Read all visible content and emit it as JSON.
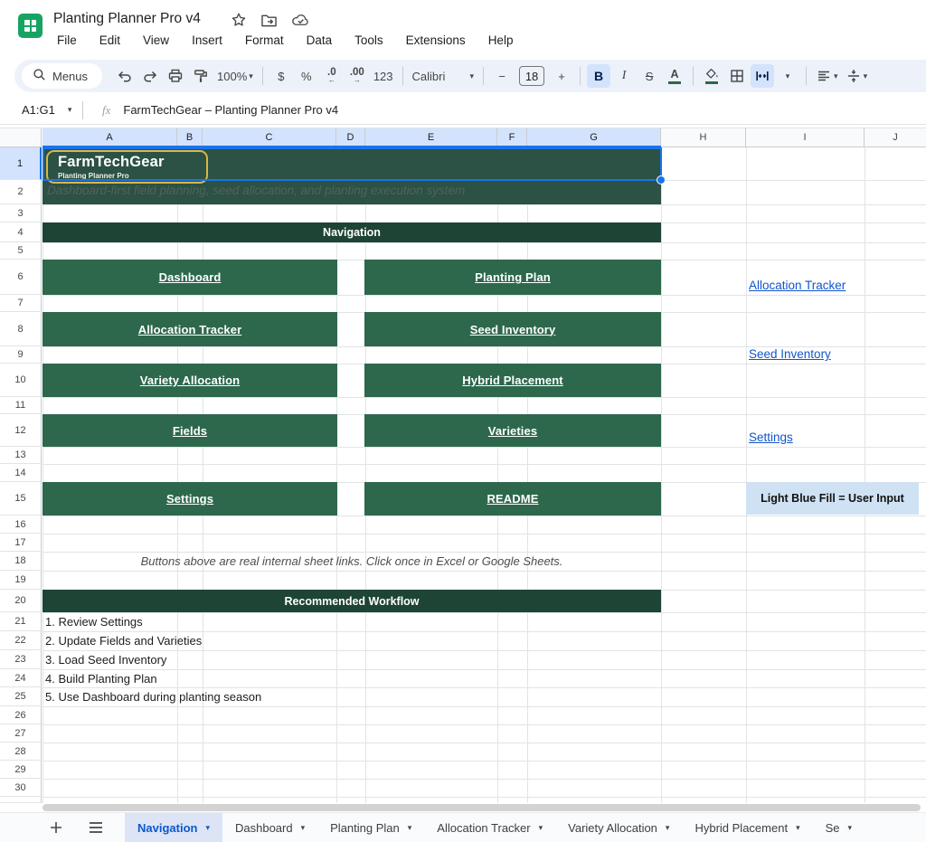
{
  "titlebar": {
    "title": "Planting Planner Pro v4",
    "menus": [
      "File",
      "Edit",
      "View",
      "Insert",
      "Format",
      "Data",
      "Tools",
      "Extensions",
      "Help"
    ]
  },
  "toolbar": {
    "search_label": "Menus",
    "zoom": "100%",
    "currency": "$",
    "percent": "%",
    "decrease_decimal": ".0",
    "decrease_decimal_arrow": "←",
    "increase_decimal": ".00",
    "increase_decimal_arrow": "→",
    "more_formats": "123",
    "font": "Calibri",
    "minus": "−",
    "font_size": "18",
    "plus": "+",
    "bold": "B",
    "italic": "I",
    "strikethrough": "S",
    "text_color": "A",
    "caret": "▾"
  },
  "formula_bar": {
    "range": "A1:G1",
    "fx": "fx",
    "formula": "FarmTechGear – Planting Planner Pro v4"
  },
  "grid": {
    "columns": [
      "A",
      "B",
      "C",
      "D",
      "E",
      "F",
      "G",
      "H",
      "I",
      "J"
    ],
    "selected_columns": 7,
    "rows": 30,
    "selected_row": 1
  },
  "content": {
    "banner": {
      "logo_title": "FarmTechGear",
      "logo_subtitle": "Planting Planner Pro",
      "subtitle": "Dashboard-first field planning, seed allocation, and planting execution system"
    },
    "nav_header": "Navigation",
    "nav_buttons": [
      [
        "Dashboard",
        "Planting Plan"
      ],
      [
        "Allocation Tracker",
        "Seed Inventory"
      ],
      [
        "Variety Allocation",
        "Hybrid Placement"
      ],
      [
        "Fields",
        "Varieties"
      ],
      [
        "Settings",
        "README"
      ]
    ],
    "side_links": [
      "Allocation Tracker",
      "Seed Inventory",
      "Settings"
    ],
    "legend": "Light Blue Fill = User Input",
    "note": "Buttons above are real internal sheet links. Click once in Excel or Google Sheets.",
    "workflow_header": "Recommended Workflow",
    "workflow_items": [
      "1. Review Settings",
      "2. Update Fields and Varieties",
      "3. Load Seed Inventory",
      "4. Build Planting Plan",
      "5. Use Dashboard during planting season"
    ]
  },
  "tabbar": {
    "tabs": [
      {
        "label": "Navigation",
        "active": true
      },
      {
        "label": "Dashboard",
        "active": false
      },
      {
        "label": "Planting Plan",
        "active": false
      },
      {
        "label": "Allocation Tracker",
        "active": false
      },
      {
        "label": "Variety Allocation",
        "active": false
      },
      {
        "label": "Hybrid Placement",
        "active": false
      },
      {
        "label": "Se",
        "active": false
      }
    ]
  },
  "colors": {
    "accent_blue": "#1a73e8",
    "link_blue": "#1155cc",
    "banner_green": "#2b5244",
    "section_green": "#1d4434",
    "button_green": "#2d684c",
    "gold_border": "#d9b64a",
    "legend_blue": "#cfe2f3",
    "selected_header": "#d3e3fd",
    "tab_active_bg": "#dce4f5",
    "tab_active_text": "#0b57d0"
  }
}
